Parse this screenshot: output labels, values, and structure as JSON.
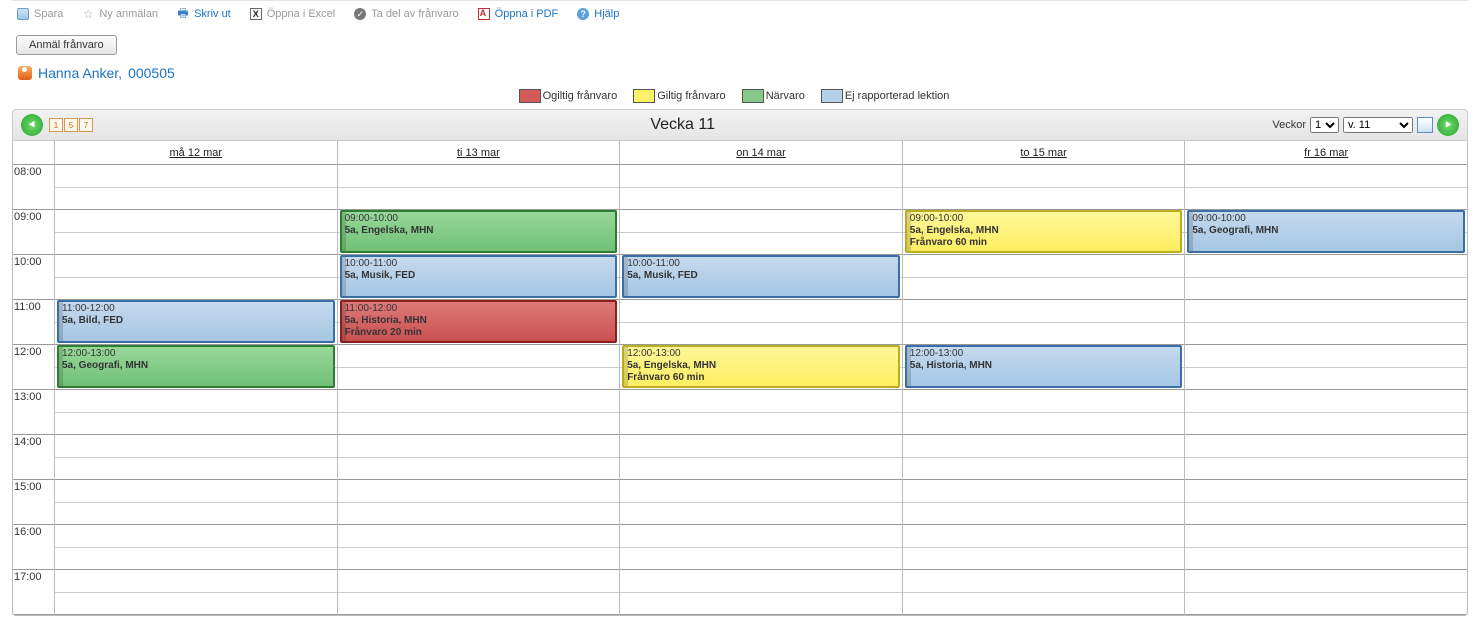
{
  "toolbar": {
    "save": "Spara",
    "new_report": "Ny anmälan",
    "print": "Skriv ut",
    "open_excel": "Öppna i Excel",
    "take_part": "Ta del av frånvaro",
    "open_pdf": "Öppna i PDF",
    "help": "Hjälp"
  },
  "btn_report_absence": "Anmäl frånvaro",
  "person": {
    "name": "Hanna Anker,",
    "id": "000505"
  },
  "legend": {
    "invalid": "Ogiltig frånvaro",
    "valid": "Giltig frånvaro",
    "attendance": "Närvaro",
    "unreported": "Ej rapporterad lektion"
  },
  "weekbar": {
    "title": "Vecka 11",
    "label": "Veckor",
    "count_sel": "1",
    "week_sel": "v. 11",
    "minical": [
      "1",
      "5",
      "7"
    ]
  },
  "days": [
    "må 12 mar",
    "ti 13 mar",
    "on 14 mar",
    "to 15 mar",
    "fr 16 mar"
  ],
  "hours": [
    "08:00",
    "09:00",
    "10:00",
    "11:00",
    "12:00",
    "13:00",
    "14:00",
    "15:00",
    "16:00",
    "17:00"
  ],
  "events": {
    "mon": [
      {
        "time": "11:00-12:00",
        "line1": "5a, Bild, FED",
        "line2": "",
        "cls": "blue",
        "startH": 11,
        "dur": 1
      },
      {
        "time": "12:00-13:00",
        "line1": "5a, Geografi, MHN",
        "line2": "",
        "cls": "green",
        "startH": 12,
        "dur": 1
      }
    ],
    "tue": [
      {
        "time": "09:00-10:00",
        "line1": "5a, Engelska, MHN",
        "line2": "",
        "cls": "green",
        "startH": 9,
        "dur": 1
      },
      {
        "time": "10:00-11:00",
        "line1": "5a, Musik, FED",
        "line2": "",
        "cls": "blue",
        "startH": 10,
        "dur": 1
      },
      {
        "time": "11:00-12:00",
        "line1": "5a, Historia, MHN",
        "line2": "Frånvaro 20 min",
        "cls": "red",
        "startH": 11,
        "dur": 1
      }
    ],
    "wed": [
      {
        "time": "10:00-11:00",
        "line1": "5a, Musik, FED",
        "line2": "",
        "cls": "blue",
        "startH": 10,
        "dur": 1
      },
      {
        "time": "12:00-13:00",
        "line1": "5a, Engelska, MHN",
        "line2": "Frånvaro 60 min",
        "cls": "yel",
        "startH": 12,
        "dur": 1
      }
    ],
    "thu": [
      {
        "time": "09:00-10:00",
        "line1": "5a, Engelska, MHN",
        "line2": "Frånvaro 60 min",
        "cls": "yel",
        "startH": 9,
        "dur": 1
      },
      {
        "time": "12:00-13:00",
        "line1": "5a, Historia, MHN",
        "line2": "",
        "cls": "blue",
        "startH": 12,
        "dur": 1
      }
    ],
    "fri": [
      {
        "time": "09:00-10:00",
        "line1": "5a, Geografi, MHN",
        "line2": "",
        "cls": "blue",
        "startH": 9,
        "dur": 1
      }
    ]
  }
}
